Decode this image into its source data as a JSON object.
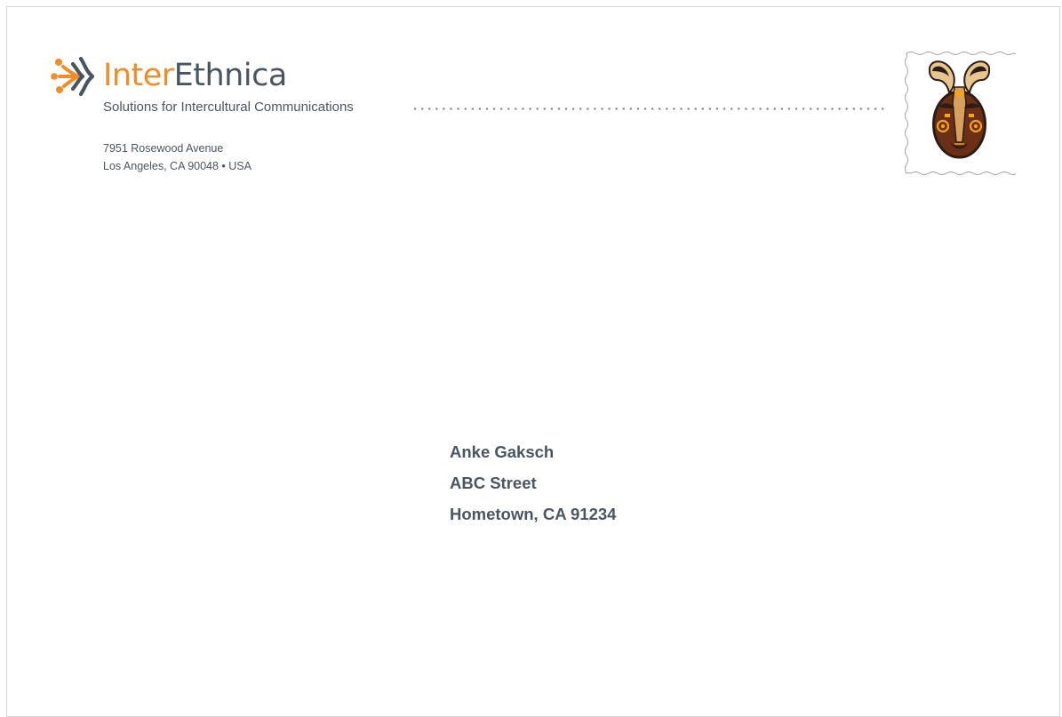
{
  "brand": {
    "name_part1": "Inter",
    "name_part2": "Ethnica",
    "tagline": "Solutions for Intercultural Communications",
    "logo_icon": "interethnica-logo-icon",
    "colors": {
      "orange": "#f28c28",
      "slate": "#4a5560"
    }
  },
  "sender": {
    "street": "7951 Rosewood Avenue",
    "city_line": "Los Angeles, CA 90048 • USA"
  },
  "stamp": {
    "icon": "tribal-mask-icon"
  },
  "recipient": {
    "name": "Anke Gaksch",
    "street": "ABC Street",
    "city_line": "Hometown, CA 91234"
  }
}
